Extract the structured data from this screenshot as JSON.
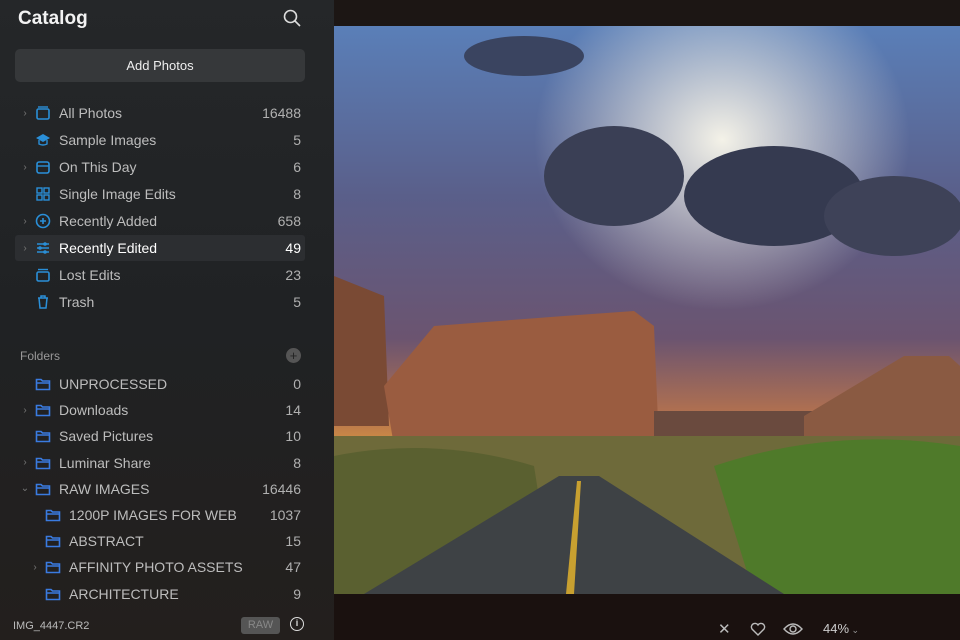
{
  "sidebar": {
    "title": "Catalog",
    "add_photos": "Add Photos",
    "catalog_items": [
      {
        "label": "All Photos",
        "count": "16488",
        "icon": "all-photos-icon"
      },
      {
        "label": "Sample Images",
        "count": "5",
        "icon": "graduation-cap-icon"
      },
      {
        "label": "On This Day",
        "count": "6",
        "icon": "calendar-icon"
      },
      {
        "label": "Single Image Edits",
        "count": "8",
        "icon": "grid-icon"
      },
      {
        "label": "Recently Added",
        "count": "658",
        "icon": "plus-circle-icon"
      },
      {
        "label": "Recently Edited",
        "count": "49",
        "icon": "sliders-icon"
      },
      {
        "label": "Lost Edits",
        "count": "23",
        "icon": "album-icon"
      },
      {
        "label": "Trash",
        "count": "5",
        "icon": "trash-icon"
      }
    ],
    "folders_heading": "Folders",
    "folders": [
      {
        "label": "UNPROCESSED",
        "count": "0"
      },
      {
        "label": "Downloads",
        "count": "14"
      },
      {
        "label": "Saved Pictures",
        "count": "10"
      },
      {
        "label": "Luminar Share",
        "count": "8"
      },
      {
        "label": "RAW IMAGES",
        "count": "16446"
      },
      {
        "label": "1200P IMAGES FOR WEB",
        "count": "1037"
      },
      {
        "label": "ABSTRACT",
        "count": "15"
      },
      {
        "label": "AFFINITY PHOTO ASSETS",
        "count": "47"
      },
      {
        "label": "ARCHITECTURE",
        "count": "9"
      }
    ],
    "filename": "IMG_4447.CR2",
    "format_badge": "RAW",
    "info_glyph": "i"
  },
  "viewer": {
    "zoom": "44%"
  },
  "colors": {
    "accent": "#2a8fd8",
    "folder": "#3a7be0"
  }
}
